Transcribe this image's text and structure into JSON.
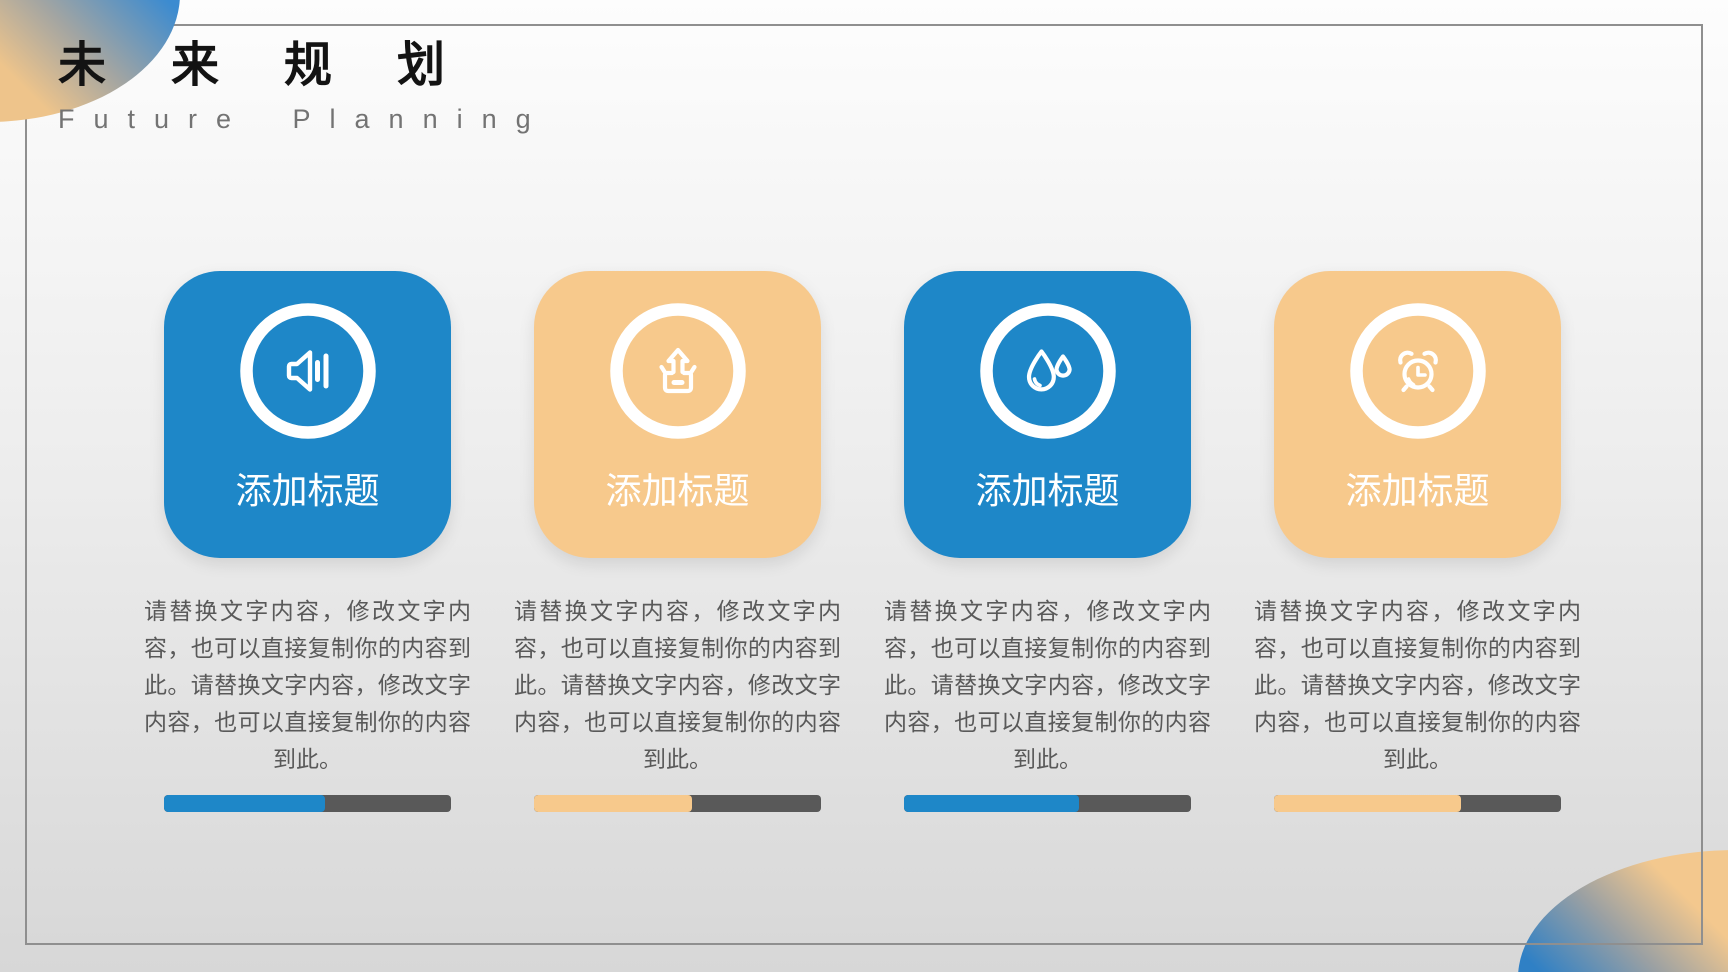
{
  "slide": {
    "title": "未来规划",
    "subtitle": "Future Planning"
  },
  "colors": {
    "blue": "#1e87c8",
    "orange": "#f7c98c",
    "bar_track": "#595959"
  },
  "cards": [
    {
      "accent": "blue",
      "icon": "speaker-icon",
      "title": "添加标题",
      "body": "请替换文字内容，修改文字内容，也可以直接复制你的内容到此。请替换文字内容，修改文字内容，也可以直接复制你的内容到此。",
      "progress_percent": 56
    },
    {
      "accent": "orange",
      "icon": "box-upload-icon",
      "title": "添加标题",
      "body": "请替换文字内容，修改文字内容，也可以直接复制你的内容到此。请替换文字内容，修改文字内容，也可以直接复制你的内容到此。",
      "progress_percent": 55
    },
    {
      "accent": "blue",
      "icon": "water-drops-icon",
      "title": "添加标题",
      "body": "请替换文字内容，修改文字内容，也可以直接复制你的内容到此。请替换文字内容，修改文字内容，也可以直接复制你的内容到此。",
      "progress_percent": 61
    },
    {
      "accent": "orange",
      "icon": "alarm-clock-icon",
      "title": "添加标题",
      "body": "请替换文字内容，修改文字内容，也可以直接复制你的内容到此。请替换文字内容，修改文字内容，也可以直接复制你的内容到此。",
      "progress_percent": 65
    }
  ]
}
